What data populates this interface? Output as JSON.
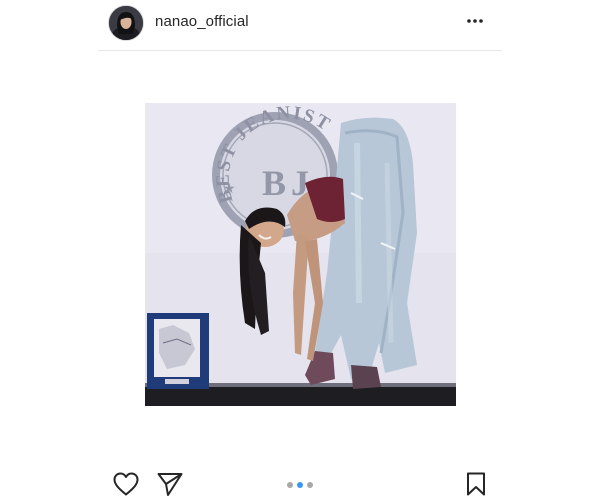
{
  "post": {
    "username": "nanao_official",
    "photo_sign_text": "BEST JEANIST",
    "carousel": {
      "total": 3,
      "active_index": 1
    }
  },
  "colors": {
    "accent": "#3897f0",
    "text": "#262626",
    "divider": "#e6e6e6",
    "dot_inactive": "#a8a8a8"
  },
  "icons": {
    "more": "more-horizontal-icon",
    "like": "heart-icon",
    "share": "paper-plane-icon",
    "save": "bookmark-icon"
  }
}
